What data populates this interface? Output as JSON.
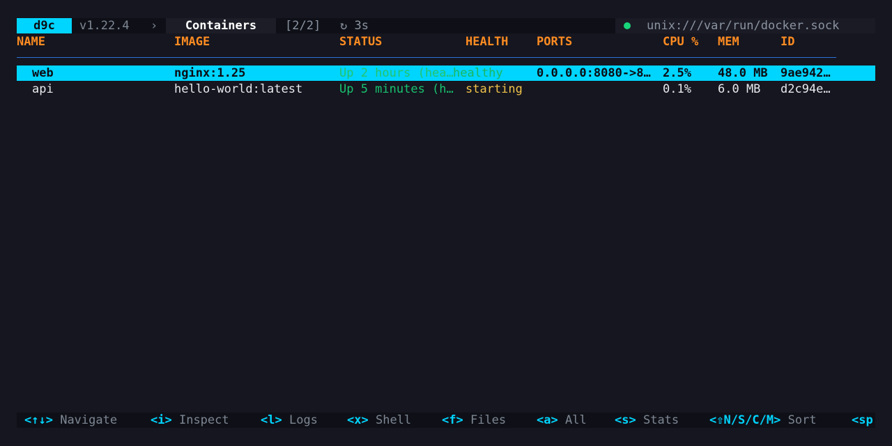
{
  "topbar": {
    "brand": "d9c",
    "version": "v1.22.4",
    "chevron": "›",
    "view": "Containers",
    "count": "[2/2]",
    "refresh": "↻ 3s",
    "status_color": "#18d67a",
    "socket": "unix:///var/run/docker.sock"
  },
  "columns": {
    "name": "NAME",
    "image": "IMAGE",
    "status": "STATUS",
    "health": "HEALTH",
    "ports": "PORTS",
    "cpu": "CPU %",
    "mem": "MEM",
    "id": "ID"
  },
  "rows": [
    {
      "name": "web",
      "image": "nginx:1.25",
      "status": "Up 2 hours (hea…",
      "health": "healthy",
      "ports": "0.0.0.0:8080->8…",
      "cpu": "2.5%",
      "mem": "48.0 MB",
      "id": "9ae942…",
      "selected": true
    },
    {
      "name": "api",
      "image": "hello-world:latest",
      "status": "Up 5 minutes (h…",
      "health": "starting",
      "ports": "",
      "cpu": "0.1%",
      "mem": "6.0 MB",
      "id": "d2c94e…",
      "selected": false
    }
  ],
  "footer": [
    {
      "key": "<↑↓>",
      "action": "Navigate"
    },
    {
      "key": "<i>",
      "action": "Inspect"
    },
    {
      "key": "<l>",
      "action": "Logs"
    },
    {
      "key": "<x>",
      "action": "Shell"
    },
    {
      "key": "<f>",
      "action": "Files"
    },
    {
      "key": "<a>",
      "action": "All"
    },
    {
      "key": "<s>",
      "action": "Stats"
    },
    {
      "key": "<⇧N/S/C/M>",
      "action": "Sort"
    },
    {
      "key": "<sp",
      "action": ""
    }
  ],
  "colors": {
    "accent": "#00d5ff",
    "header": "#ff8c22",
    "healthy": "#1ab85c",
    "starting": "#f0c24a",
    "background": "#15161f"
  }
}
